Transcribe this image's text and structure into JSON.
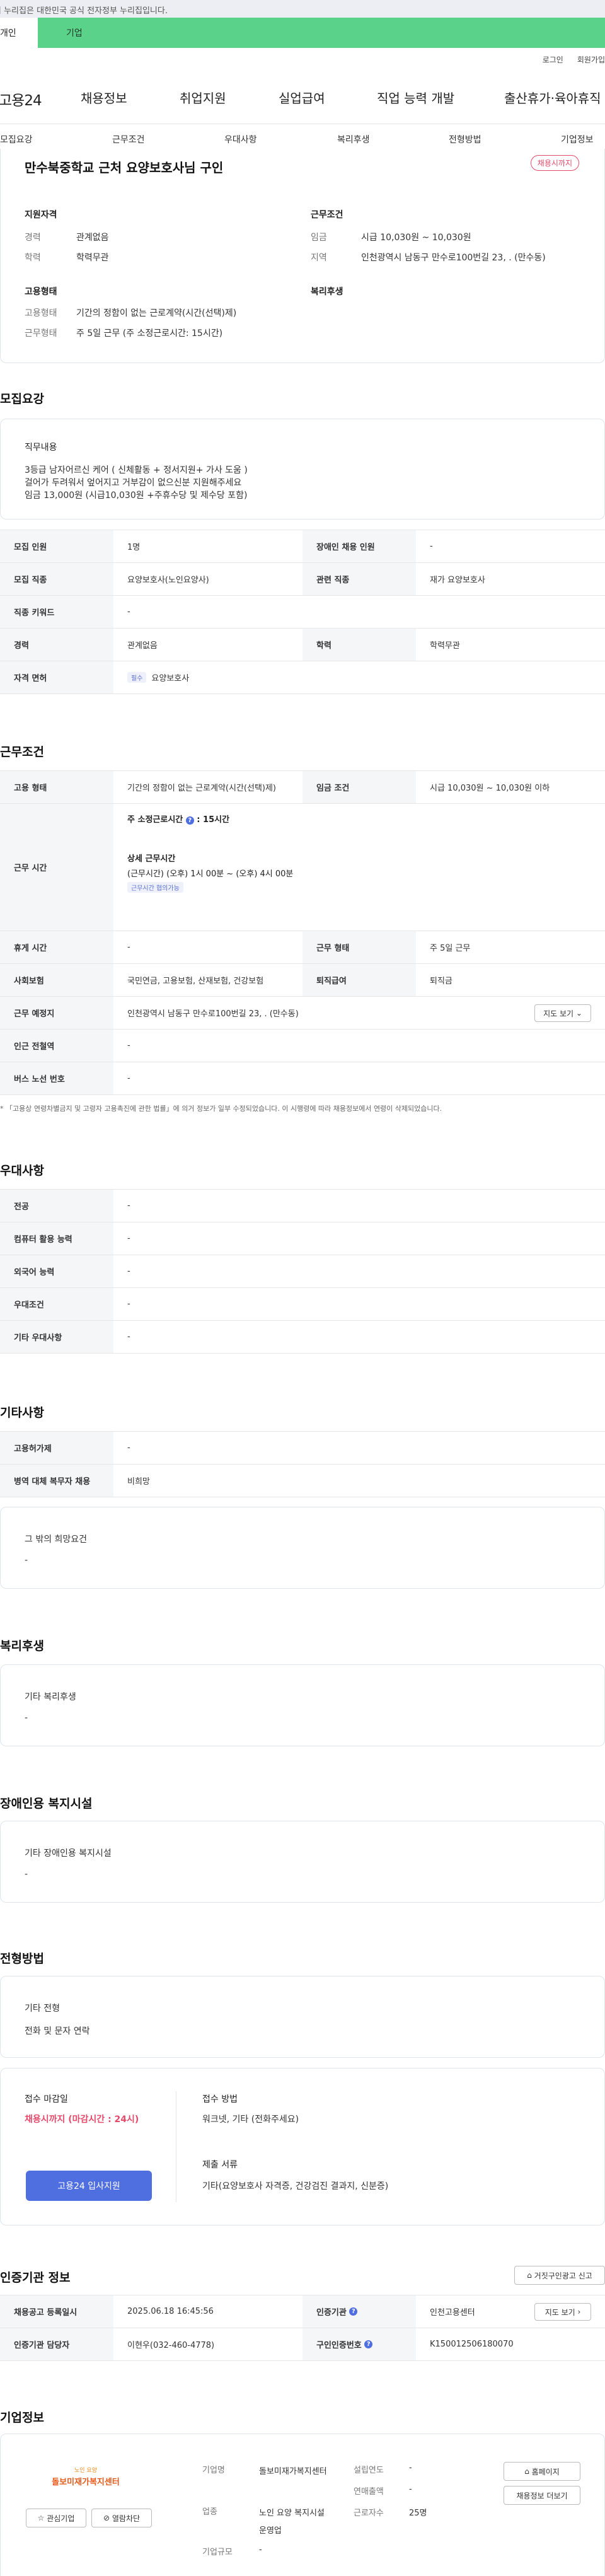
{
  "gov_banner": "이 누리집은 대한민국 공식 전자정부 누리집입니다.",
  "top_tabs": [
    "개인",
    "기업"
  ],
  "util": [
    "로그인",
    "회원가입"
  ],
  "gnb": {
    "logo": "고용24",
    "items": [
      "채용정보",
      "취업지원",
      "실업급여",
      "직업 능력 개발",
      "출산휴가·육아휴직"
    ]
  },
  "subnav": [
    "모집요강",
    "근무조건",
    "우대사항",
    "복리후생",
    "전형방법",
    "기업정보"
  ],
  "title_card": {
    "title": "만수북중학교 근처 요양보호사님 구인",
    "status": "채용시까지",
    "qual_head": "지원자격",
    "qual_rows": [
      [
        "경력",
        "관계없음"
      ],
      [
        "학력",
        "학력무관"
      ]
    ],
    "cond_head": "근무조건",
    "cond_rows": [
      [
        "임금",
        "시급 10,030원 ~ 10,030원"
      ],
      [
        "지역",
        "인천광역시 남동구 만수로100번길 23, . (만수동)"
      ]
    ],
    "emp_head": "고용형태",
    "emp_rows": [
      [
        "고용형태",
        "기간의 정함이 없는 근로계약(시간(선택)제)"
      ],
      [
        "근무형태",
        "주 5일 근무 (주 소정근로시간: 15시간)"
      ]
    ],
    "welfare_head": "복리후생"
  },
  "recruit": {
    "heading": "모집요강",
    "duty_head": "직무내용",
    "duty_lines": [
      "3등급 남자어르신 케어 ( 신체활동 + 정서지원+ 가사 도움 )",
      "걸어가 두려워서 엎어지고 거부감이 없으신분 지원해주세요",
      "임금 13,000원 (시급10,030원 +주휴수당 및 제수당 포함)"
    ],
    "rows": [
      [
        "모집 인원",
        "1명",
        "장애인 채용 인원",
        "-"
      ],
      [
        "모집 직종",
        "요양보호사(노인요양사)",
        "관련 직종",
        "재가 요양보호사"
      ],
      [
        "직종 키워드",
        "-",
        "",
        ""
      ],
      [
        "경력",
        "관계없음",
        "학력",
        "학력무관"
      ]
    ],
    "license_head": "자격 면허",
    "license_tag": "필수",
    "license_val": "요양보호사"
  },
  "conditions": {
    "heading": "근무조건",
    "emp_type_label": "고용 형태",
    "emp_type": "기간의 정함이 없는 근로계약(시간(선택)제)",
    "wage_label": "임금 조건",
    "wage": "시급 10,030원 ~ 10,030원 이하",
    "time_label": "근무 시간",
    "weekly_label": "주 소정근로시간",
    "weekly_val": "15시간",
    "detail_label": "상세 근무시간",
    "detail_val": "(근무시간) (오후) 1시 00분 ~ (오후) 4시 00분",
    "consult": "근무시간 협의가능",
    "rows": [
      [
        "휴게 시간",
        "-",
        "근무 형태",
        "주 5일 근무"
      ],
      [
        "사회보험",
        "국민연금, 고용보험, 산재보험, 건강보험",
        "퇴직급여",
        "퇴직금"
      ]
    ],
    "place_label": "근무 예정지",
    "place": "인천광역시 남동구 만수로100번길 23, . (만수동)",
    "map_btn": "지도 보기",
    "station_label": "인근 전철역",
    "station": "-",
    "bus_label": "버스 노선 번호",
    "bus": "-",
    "note": "* 「고용상 연령차별금지 및 고령자 고용촉진에 관한 법률」에 의거 정보가 일부 수정되었습니다. 이 시행령에 따라 채용정보에서 연령이 삭제되었습니다."
  },
  "pref": {
    "heading": "우대사항",
    "rows": [
      [
        "전공",
        "-"
      ],
      [
        "컴퓨터 활용 능력",
        "-"
      ],
      [
        "외국어 능력",
        "-"
      ],
      [
        "우대조건",
        "-"
      ],
      [
        "기타 우대사항",
        "-"
      ]
    ]
  },
  "other": {
    "heading": "기타사항",
    "rows": [
      [
        "고용허가제",
        "-"
      ],
      [
        "병역 대체 복무자 채용",
        "비희망"
      ]
    ],
    "extra_head": "그 밖의 희망요건",
    "extra_val": "-"
  },
  "welfare": {
    "heading": "복리후생",
    "head": "기타 복리후생",
    "val": "-"
  },
  "disabled": {
    "heading": "장애인용 복지시설",
    "head": "기타 장애인용 복지시설",
    "val": "-"
  },
  "process": {
    "heading": "전형방법",
    "head": "기타 전형",
    "val": "전화 및 문자 연락",
    "deadline_label": "접수 마감일",
    "deadline": "채용시까지 (마감시간 : 24시)",
    "method_label": "접수 방법",
    "method": "워크넷, 기타 (전화주세요)",
    "docs_label": "제출 서류",
    "docs": "기타(요양보호사 자격증, 건강검진 결과지, 신분증)",
    "apply_btn": "고용24 입사지원"
  },
  "agency": {
    "heading": "인증기관 정보",
    "report_btn": "거짓구인광고 신고",
    "reg_label": "채용공고 등록일시",
    "reg": "2025.06.18 16:45:56",
    "org_label": "인증기관",
    "org": "인천고용센터",
    "map_btn": "지도 보기",
    "manager_label": "인증기관 담당자",
    "manager": "이현우(032-460-4778)",
    "num_label": "구인인증번호",
    "num": "K150012506180070"
  },
  "company": {
    "heading": "기업정보",
    "logo_small": "노인 요양",
    "logo_text": "돌보미재가복지센터",
    "follow_btn": "관심기업",
    "block_btn": "열람차단",
    "name_label": "기업명",
    "name": "돌보미재가복지센터",
    "biz_label": "업종",
    "biz": "노인 요양 복지시설 운영업",
    "scale_label": "기업규모",
    "scale": "-",
    "est_label": "설립연도",
    "est": "-",
    "sales_label": "연매출액",
    "sales": "-",
    "emp_label": "근로자수",
    "emp": "25명",
    "home_btn": "홈페이지",
    "jobs_btn": "채용정보 더보기"
  },
  "colors": {
    "brand_green": "#5bd28a",
    "accent_blue": "#4f6ee0",
    "status_pink": "#e44a6a"
  }
}
